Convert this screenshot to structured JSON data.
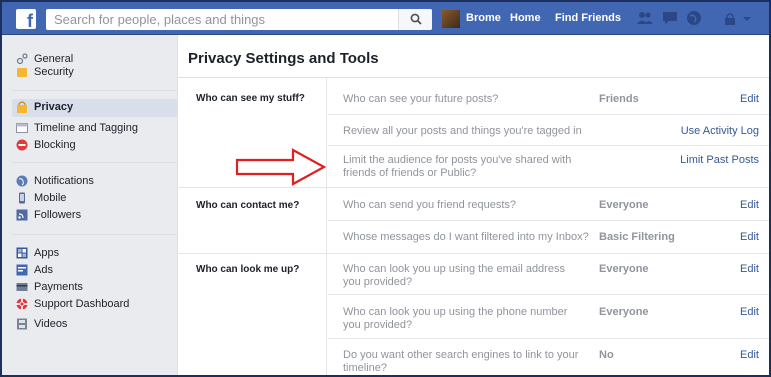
{
  "topbar": {
    "logo": "f",
    "search_placeholder": "Search for people, places and things",
    "user_name": "Brome",
    "home": "Home",
    "find_friends": "Find Friends",
    "brand_color": "#4267b2"
  },
  "sidebar": {
    "groups": [
      [
        {
          "label": "General",
          "icon": "gear-icon",
          "active": false
        },
        {
          "label": "Security",
          "icon": "lock-icon",
          "active": false
        }
      ],
      [
        {
          "label": "Privacy",
          "icon": "privacy-lock-icon",
          "active": true
        },
        {
          "label": "Timeline and Tagging",
          "icon": "timeline-icon",
          "active": false
        },
        {
          "label": "Blocking",
          "icon": "block-icon",
          "active": false
        }
      ],
      [
        {
          "label": "Notifications",
          "icon": "globe-icon",
          "active": false
        },
        {
          "label": "Mobile",
          "icon": "phone-icon",
          "active": false
        },
        {
          "label": "Followers",
          "icon": "rss-icon",
          "active": false
        }
      ],
      [
        {
          "label": "Apps",
          "icon": "apps-icon",
          "active": false
        },
        {
          "label": "Ads",
          "icon": "ads-icon",
          "active": false
        },
        {
          "label": "Payments",
          "icon": "card-icon",
          "active": false
        },
        {
          "label": "Support Dashboard",
          "icon": "lifebuoy-icon",
          "active": false
        },
        {
          "label": "Videos",
          "icon": "film-icon",
          "active": false
        }
      ]
    ]
  },
  "main": {
    "title": "Privacy Settings and Tools",
    "sections": [
      {
        "label": "Who can see my stuff?",
        "rows": [
          {
            "question": "Who can see your future posts?",
            "value": "Friends",
            "action": "Edit"
          },
          {
            "question": "Review all your posts and things you're tagged in",
            "value": "",
            "action": "Use Activity Log"
          },
          {
            "question": "Limit the audience for posts you've shared with friends of friends or Public?",
            "value": "",
            "action": "Limit Past Posts"
          }
        ]
      },
      {
        "label": "Who can contact me?",
        "rows": [
          {
            "question": "Who can send you friend requests?",
            "value": "Everyone",
            "action": "Edit"
          },
          {
            "question": "Whose messages do I want filtered into my Inbox?",
            "value": "Basic Filtering",
            "action": "Edit"
          }
        ]
      },
      {
        "label": "Who can look me up?",
        "rows": [
          {
            "question": "Who can look you up using the email address you provided?",
            "value": "Everyone",
            "action": "Edit"
          },
          {
            "question": "Who can look you up using the phone number you provided?",
            "value": "Everyone",
            "action": "Edit"
          },
          {
            "question": "Do you want other search engines to link to your timeline?",
            "value": "No",
            "action": "Edit"
          }
        ]
      }
    ]
  },
  "annotation": {
    "arrow_color": "#e02020"
  }
}
